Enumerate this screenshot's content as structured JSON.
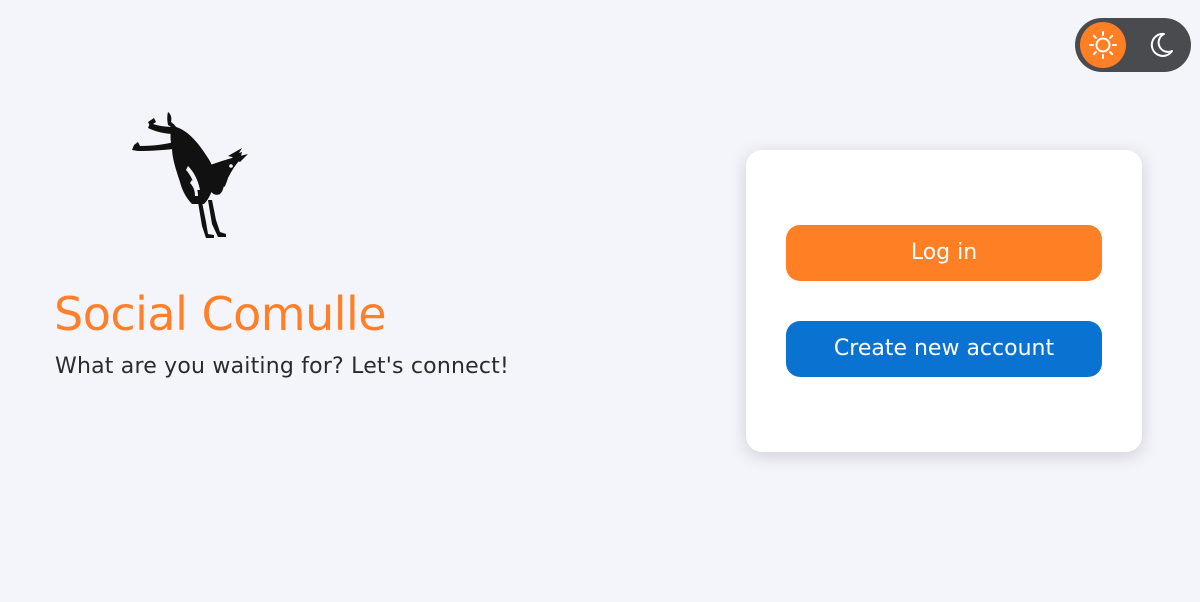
{
  "theme_toggle": {
    "active": "light",
    "sun_icon": "sun-icon",
    "moon_icon": "moon-icon",
    "accent_color": "#ff7f24"
  },
  "brand": {
    "logo_icon": "kicking-donkey-logo",
    "title": "Social Comulle",
    "tagline": "What are you waiting for? Let's connect!",
    "title_color": "#ff7f2a"
  },
  "auth_card": {
    "login_label": "Log in",
    "login_color": "#ff7f24",
    "create_account_label": "Create new account",
    "create_account_color": "#0a73d1"
  }
}
